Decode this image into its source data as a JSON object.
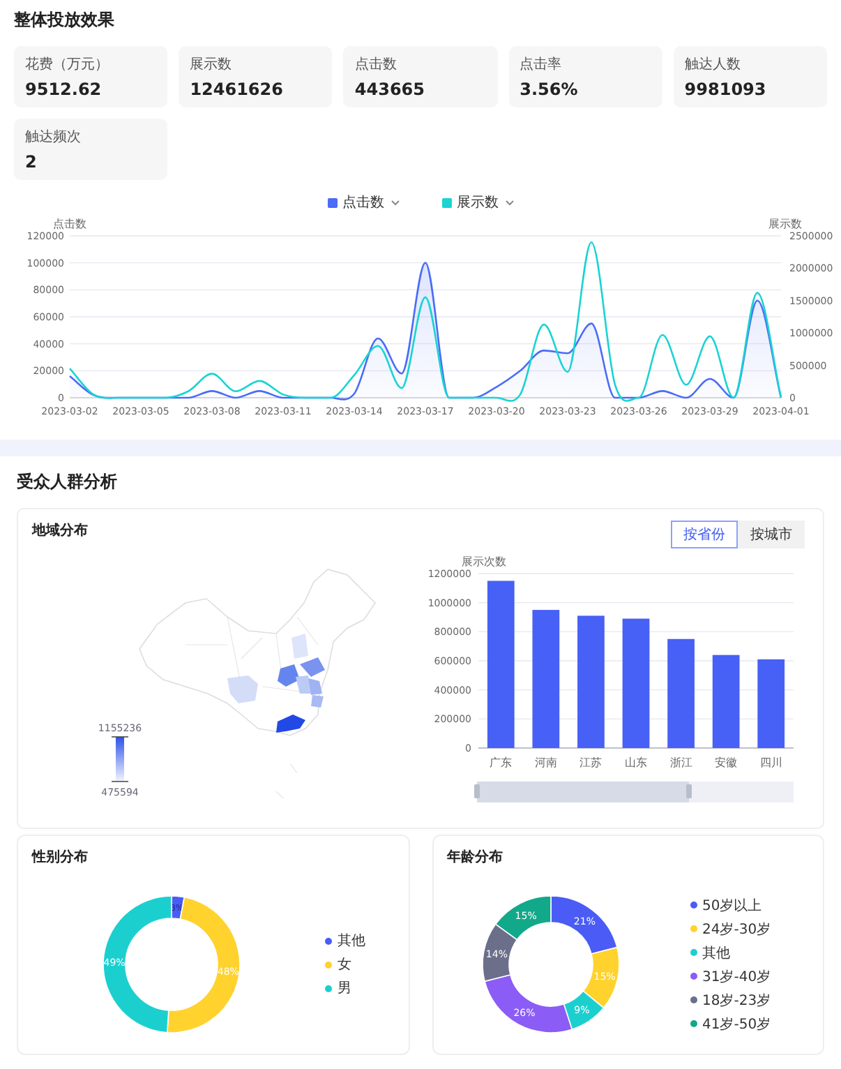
{
  "overview": {
    "title": "整体投放效果",
    "metrics": [
      {
        "label": "花费（万元）",
        "value": "9512.62"
      },
      {
        "label": "展示数",
        "value": "12461626"
      },
      {
        "label": "点击数",
        "value": "443665"
      },
      {
        "label": "点击率",
        "value": "3.56%"
      },
      {
        "label": "触达人数",
        "value": "9981093"
      },
      {
        "label": "触达频次",
        "value": "2"
      }
    ],
    "trend": {
      "chart_data": {
        "type": "line",
        "legend": "top",
        "ylabel": "点击数",
        "y2label": "展示数",
        "grid": true,
        "categories": [
          "2023-03-02",
          null,
          null,
          "2023-03-05",
          null,
          null,
          "2023-03-08",
          null,
          null,
          "2023-03-11",
          null,
          null,
          "2023-03-14",
          null,
          null,
          "2023-03-17",
          null,
          null,
          "2023-03-20",
          null,
          null,
          "2023-03-23",
          null,
          null,
          "2023-03-26",
          null,
          null,
          "2023-03-29",
          null,
          null,
          "2023-04-01"
        ],
        "ylim": [
          0,
          120000
        ],
        "y2lim": [
          0,
          2500000
        ],
        "yticks": [
          0,
          20000,
          40000,
          60000,
          80000,
          100000,
          120000
        ],
        "y2ticks": [
          0,
          500000,
          1000000,
          1500000,
          2000000,
          2500000
        ],
        "series": [
          {
            "name": "点击数",
            "color": "#4a6cf7",
            "type": "area",
            "values": [
              16000,
              2000,
              0,
              0,
              0,
              0,
              5000,
              0,
              5000,
              0,
              0,
              0,
              3000,
              44000,
              18000,
              100000,
              0,
              0,
              8000,
              20000,
              35000,
              33000,
              55000,
              0,
              0,
              5000,
              0,
              14000,
              0,
              72000,
              0
            ]
          },
          {
            "name": "展示数",
            "color": "#1ad3d3",
            "axis": "y2",
            "values": [
              450000,
              50000,
              0,
              0,
              0,
              100000,
              370000,
              100000,
              260000,
              50000,
              0,
              0,
              350000,
              800000,
              150000,
              1550000,
              0,
              0,
              0,
              50000,
              1130000,
              400000,
              2400000,
              200000,
              0,
              970000,
              200000,
              950000,
              0,
              1620000,
              0
            ]
          }
        ]
      }
    }
  },
  "audience": {
    "title": "受众人群分析",
    "region": {
      "title": "地域分布",
      "tabs": [
        {
          "label": "按省份",
          "selected": true
        },
        {
          "label": "按城市",
          "selected": false
        }
      ],
      "map_scale": {
        "max_label": "1155236",
        "min_label": "475594"
      },
      "chart_data": {
        "type": "bar",
        "ylabel": "展示次数",
        "grid": true,
        "categories": [
          "广东",
          "河南",
          "江苏",
          "山东",
          "浙江",
          "安徽",
          "四川"
        ],
        "values": [
          1150000,
          950000,
          910000,
          890000,
          750000,
          640000,
          610000
        ],
        "ylim": [
          0,
          1200000
        ],
        "yticks": [
          0,
          200000,
          400000,
          600000,
          800000,
          1000000,
          1200000
        ]
      }
    },
    "gender": {
      "title": "性别分布",
      "legend": [
        {
          "color": "#4a5cf5"
        },
        {
          "color": "#ffd22e"
        },
        {
          "color": "#1ccfcf"
        }
      ],
      "chart_data": {
        "type": "donut",
        "categories": [
          "其他",
          "女",
          "男"
        ],
        "values": [
          3,
          48,
          49
        ],
        "value_labels": [
          "3%",
          "48%",
          "49%"
        ]
      }
    },
    "age": {
      "title": "年龄分布",
      "legend": [
        {
          "color": "#4a5cf5"
        },
        {
          "color": "#ffd22e"
        },
        {
          "color": "#1ccfcf"
        },
        {
          "color": "#8b5cf6"
        },
        {
          "color": "#6b6f8a"
        },
        {
          "color": "#12a88a"
        }
      ],
      "chart_data": {
        "type": "donut",
        "categories": [
          "50岁以上",
          "24岁-30岁",
          "其他",
          "31岁-40岁",
          "18岁-23岁",
          "41岁-50岁"
        ],
        "values": [
          21,
          15,
          9,
          26,
          14,
          15
        ],
        "value_labels": [
          "21%",
          "15%",
          "9%",
          "26%",
          "14%",
          "15%"
        ]
      }
    }
  }
}
